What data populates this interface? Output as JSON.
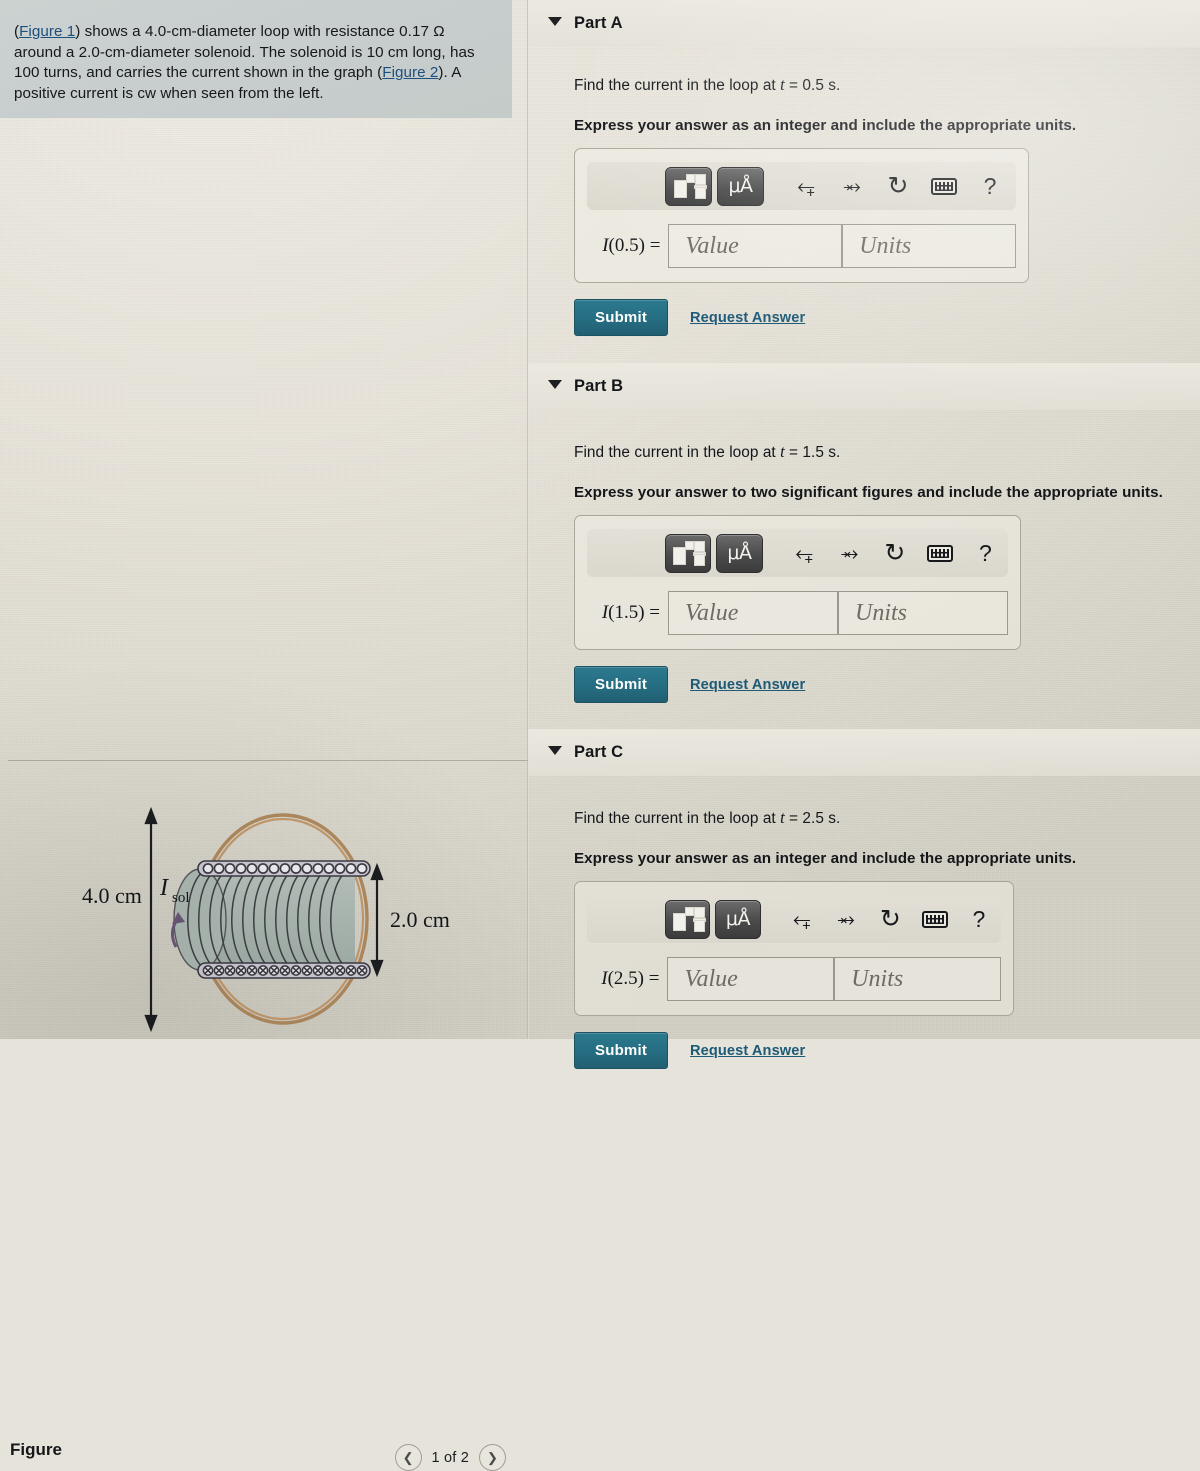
{
  "problem": {
    "text_before_link1": "(",
    "link1": "Figure 1",
    "text_mid": ") shows a 4.0-cm-diameter loop with resistance 0.17 Ω around a 2.0-cm-diameter solenoid.  The solenoid is 10 cm long, has 100 turns, and carries the current shown in the graph (",
    "link2": "Figure 2",
    "text_after": "). A positive current is cw when seen from the left."
  },
  "figure_panel": {
    "title": "Figure",
    "prev_icon": "chevron-left-icon",
    "next_icon": "chevron-right-icon",
    "counter": "1 of 2",
    "diagram": {
      "label_left": "4.0 cm",
      "label_right": "2.0 cm",
      "current_label_main": "I",
      "current_label_sub": "sol",
      "loop_color": "#b08a5f",
      "solenoid_fill": "#aebab4",
      "wire_color": "#3b3a42"
    }
  },
  "toolbar": {
    "template_icon": "math-template-icon",
    "units_icon": "micro-angstrom-units-icon",
    "units_label": "μÅ",
    "undo_icon": "undo-arrow-icon",
    "redo_icon": "redo-arrow-icon",
    "reset_icon": "reset-circle-icon",
    "keyboard_icon": "keyboard-icon",
    "help_icon": "question-mark-icon",
    "help_label": "?"
  },
  "fields": {
    "value_placeholder": "Value",
    "units_placeholder": "Units"
  },
  "buttons": {
    "submit_label": "Submit",
    "request_answer_label": "Request Answer",
    "submit_color": "#277084",
    "link_color": "#1d5a78"
  },
  "parts": [
    {
      "id": "a",
      "title": "Part A",
      "caret_icon": "caret-down-icon",
      "prompt_prefix": "Find the current in the loop at ",
      "prompt_var": "t",
      "prompt_suffix": " = 0.5 s.",
      "instruction": "Express your answer as an integer and include the appropriate units.",
      "field_label_var": "I",
      "field_label_arg": "(0.5) ="
    },
    {
      "id": "b",
      "title": "Part B",
      "caret_icon": "caret-down-icon",
      "prompt_prefix": "Find the current in the loop at ",
      "prompt_var": "t",
      "prompt_suffix": " = 1.5 s.",
      "instruction": "Express your answer to two significant figures and include the appropriate units.",
      "field_label_var": "I",
      "field_label_arg": "(1.5) ="
    },
    {
      "id": "c",
      "title": "Part C",
      "caret_icon": "caret-down-icon",
      "prompt_prefix": "Find the current in the loop at ",
      "prompt_var": "t",
      "prompt_suffix": " = 2.5 s.",
      "instruction": "Express your answer as an integer and include the appropriate units.",
      "field_label_var": "I",
      "field_label_arg": "(2.5) ="
    }
  ]
}
